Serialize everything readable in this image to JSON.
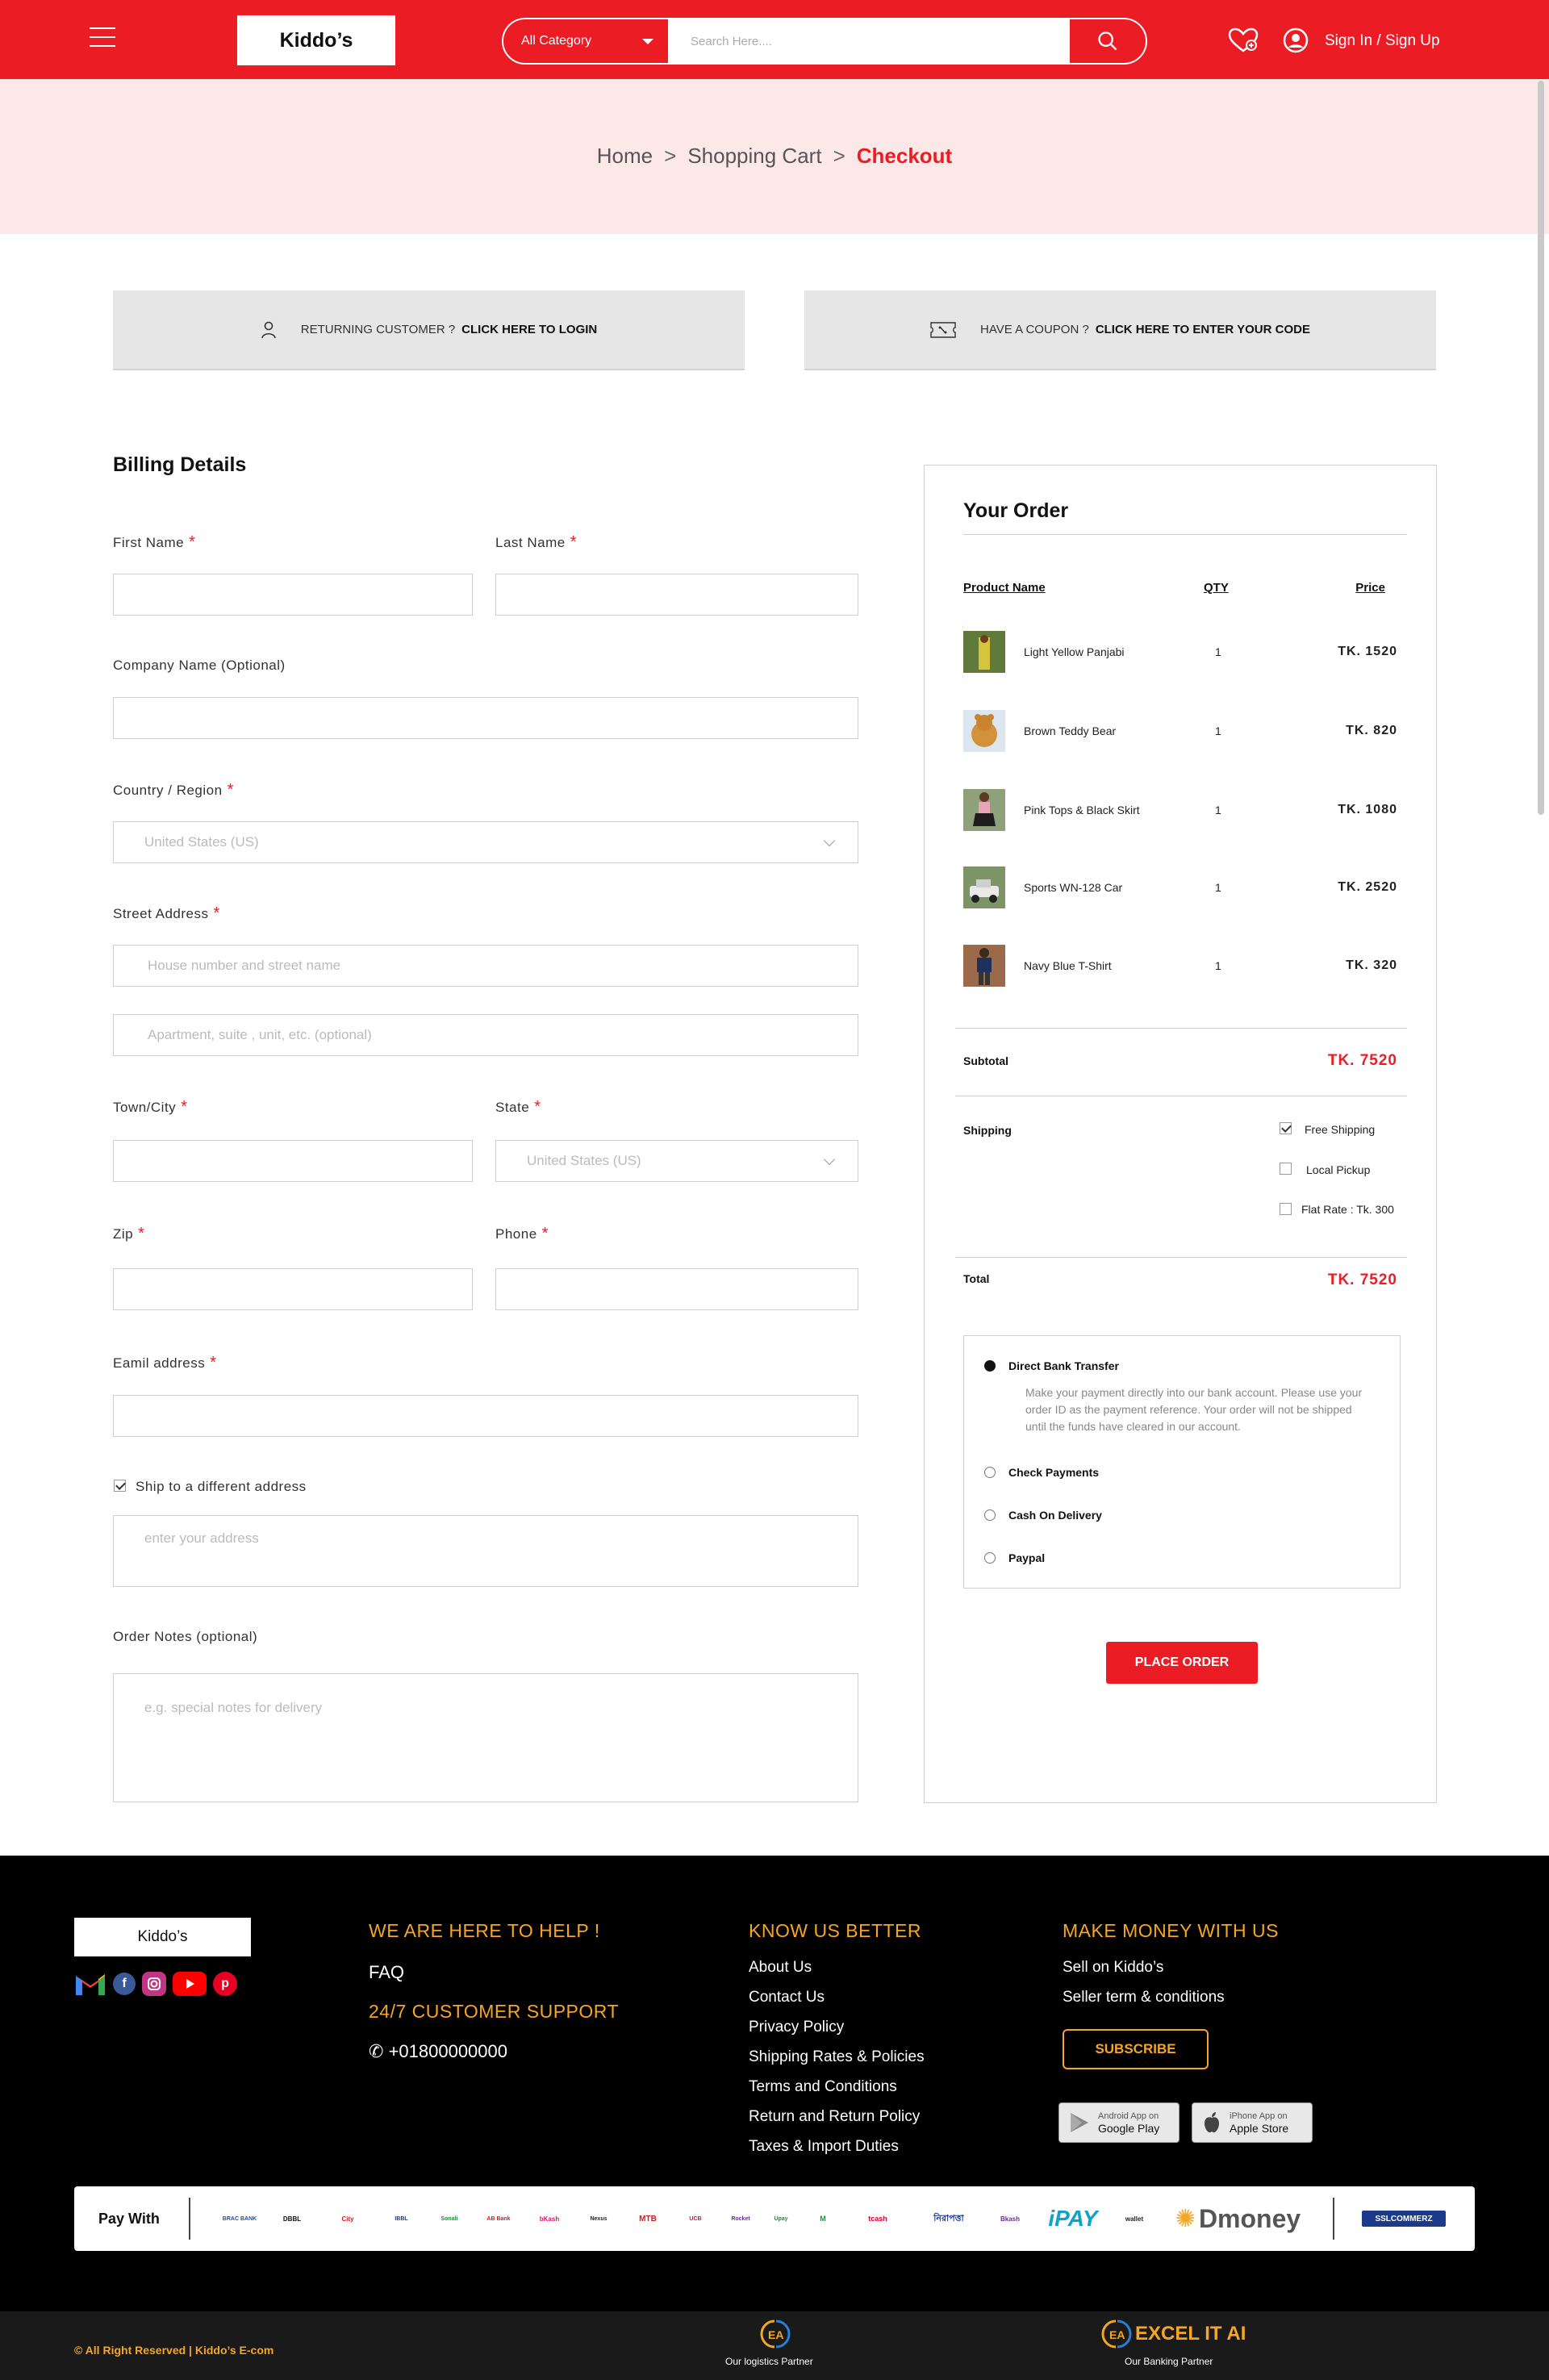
{
  "header": {
    "logo": "Kiddo’s",
    "category": "All Category",
    "search_placeholder": "Search Here....",
    "sign_in": "Sign In / Sign Up"
  },
  "breadcrumb": {
    "home": "Home",
    "cart": "Shopping Cart",
    "current": "Checkout",
    "separator": ">"
  },
  "notices": {
    "login_prefix": "RETURNING CUSTOMER ?",
    "login_link": "CLICK HERE TO LOGIN",
    "coupon_prefix": "HAVE A COUPON ?",
    "coupon_link": "CLICK HERE TO ENTER YOUR CODE"
  },
  "billing": {
    "title": "Billing Details",
    "required_mark": "*",
    "first_name": "First Name",
    "last_name": "Last Name",
    "company": "Company Name (Optional)",
    "country": "Country / Region",
    "country_value": "United States (US)",
    "street": "Street Address",
    "street_ph1": "House number and street name",
    "street_ph2": "Apartment, suite , unit, etc. (optional)",
    "town": "Town/City",
    "state": "State",
    "state_value": "United States (US)",
    "zip": "Zip",
    "phone": "Phone",
    "email": "Eamil address",
    "ship_diff": "Ship to a different address",
    "ship_diff_checked": true,
    "ship_address_ph": "enter your address",
    "notes": "Order Notes (optional)",
    "notes_ph": "e.g. special notes for delivery"
  },
  "order": {
    "title": "Your Order",
    "col_name": "Product Name",
    "col_qty": "QTY",
    "col_price": "Price",
    "items": [
      {
        "name": "Light Yellow Panjabi",
        "qty": "1",
        "price": "TK. 1520",
        "thumb_color": "#b9a83c"
      },
      {
        "name": "Brown Teddy Bear",
        "qty": "1",
        "price": "TK. 820",
        "thumb_color": "#d49a3f"
      },
      {
        "name": "Pink Tops & Black Skirt",
        "qty": "1",
        "price": "TK. 1080",
        "thumb_color": "#7c8a5c"
      },
      {
        "name": "Sports WN-128 Car",
        "qty": "1",
        "price": "TK. 2520",
        "thumb_color": "#6b7a52"
      },
      {
        "name": "Navy Blue T-Shirt",
        "qty": "1",
        "price": "TK. 320",
        "thumb_color": "#8a5a3e"
      }
    ],
    "subtotal_label": "Subtotal",
    "subtotal": "TK. 7520",
    "shipping_label": "Shipping",
    "shipping_options": [
      {
        "label": "Free Shipping",
        "checked": true
      },
      {
        "label": "Local Pickup",
        "checked": false
      },
      {
        "label": "Flat Rate : Tk. 300",
        "checked": false
      }
    ],
    "total_label": "Total",
    "total": "TK. 7520",
    "payments": {
      "bank": "Direct Bank Transfer",
      "bank_desc": "Make your payment directly into our bank account. Please use your order ID as the payment reference. Your order will not be shipped until the funds have cleared in our account.",
      "check": "Check Payments",
      "cod": "Cash On Delivery",
      "paypal": "Paypal",
      "selected": "bank"
    },
    "place_order": "PLACE ORDER"
  },
  "footer": {
    "logo": "Kiddo’s",
    "help_title": "WE ARE HERE TO HELP !",
    "faq": "FAQ",
    "support_title": "24/7 CUSTOMER SUPPORT",
    "phone": "+01800000000",
    "know_title": "KNOW US BETTER",
    "know_links": [
      "About Us",
      "Contact Us",
      "Privacy Policy",
      "Shipping Rates & Policies",
      "Terms and Conditions",
      "Return and Return Policy",
      "Taxes & Import Duties"
    ],
    "money_title": "MAKE MONEY WITH US",
    "money_links": [
      "Sell on Kiddo’s",
      "Seller term & conditions"
    ],
    "subscribe": "SUBSCRIBE",
    "google_small": "Android App on",
    "google_big": "Google Play",
    "apple_small": "iPhone App on",
    "apple_big": "Apple Store",
    "pay_with": "Pay With",
    "pay_logos": [
      "BRAC BANK",
      "DBBL",
      "City",
      "IBBL",
      "Sonali",
      "AB Bank",
      "bKash",
      "Nexus",
      "MTB",
      "UCB",
      "Rocket",
      "Upay",
      "M",
      "tcash",
      "নিরাপত্তা",
      "Bkash",
      "iPAY",
      "wallet",
      "Dmoney",
      "SSLCOMMERZ"
    ],
    "copyright": "© All Right Reserved | Kiddo’s E-com",
    "logistics": "Our logistics Partner",
    "banking": "Our Banking Partner",
    "excel_brand": "EXCEL IT AI"
  },
  "colors": {
    "brand_red": "#ec1c24",
    "accent_orange": "#f5a623",
    "band_pink": "#fde8e8"
  }
}
